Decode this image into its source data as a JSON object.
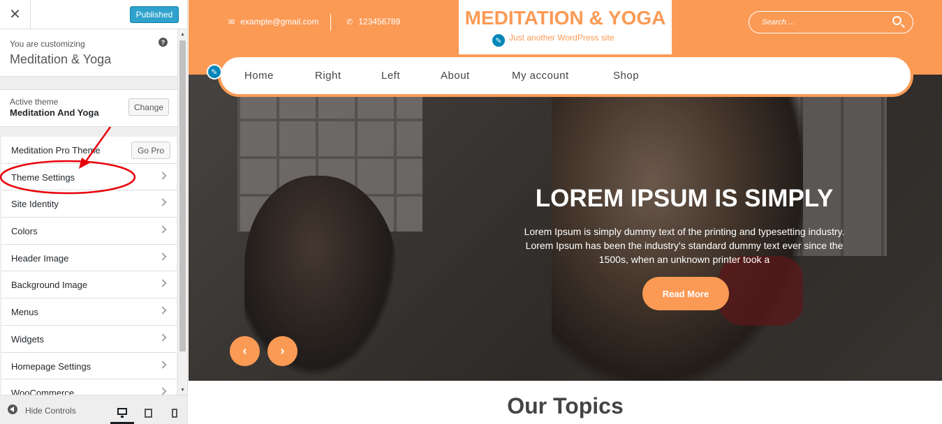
{
  "customizer": {
    "close_glyph": "✕",
    "publish_label": "Published",
    "info_small": "You are customizing",
    "info_big": "Meditation & Yoga",
    "help_glyph": "?",
    "active_theme_label": "Active theme",
    "active_theme_name": "Meditation And Yoga",
    "change_label": "Change",
    "pro_label": "Meditation Pro Theme",
    "gopro_label": "Go Pro",
    "menu_items": [
      {
        "label": "Theme Settings"
      },
      {
        "label": "Site Identity"
      },
      {
        "label": "Colors"
      },
      {
        "label": "Header Image"
      },
      {
        "label": "Background Image"
      },
      {
        "label": "Menus"
      },
      {
        "label": "Widgets"
      },
      {
        "label": "Homepage Settings"
      },
      {
        "label": "WooCommerce"
      }
    ],
    "hide_controls": "Hide Controls",
    "accent_blue": "#2ea2cc",
    "annotation_color": "#e8000b"
  },
  "site": {
    "email": "example@gmail.com",
    "phone": "123456789",
    "title": "MEDITATION & YOGA",
    "tagline": "Just another WordPress site",
    "search_placeholder": "Search ...",
    "nav": [
      "Home",
      "Right",
      "Left",
      "About",
      "My account",
      "Shop"
    ],
    "brand_color": "#fb9a55"
  },
  "hero": {
    "title": "LOREM IPSUM IS SIMPLY",
    "text": "Lorem Ipsum is simply dummy text of the printing and typesetting industry. Lorem Ipsum has been the industry's standard dummy text ever since the 1500s, when an unknown printer took a",
    "cta": "Read More",
    "prev_glyph": "‹",
    "next_glyph": "›"
  },
  "section": {
    "topics_title": "Our Topics"
  }
}
